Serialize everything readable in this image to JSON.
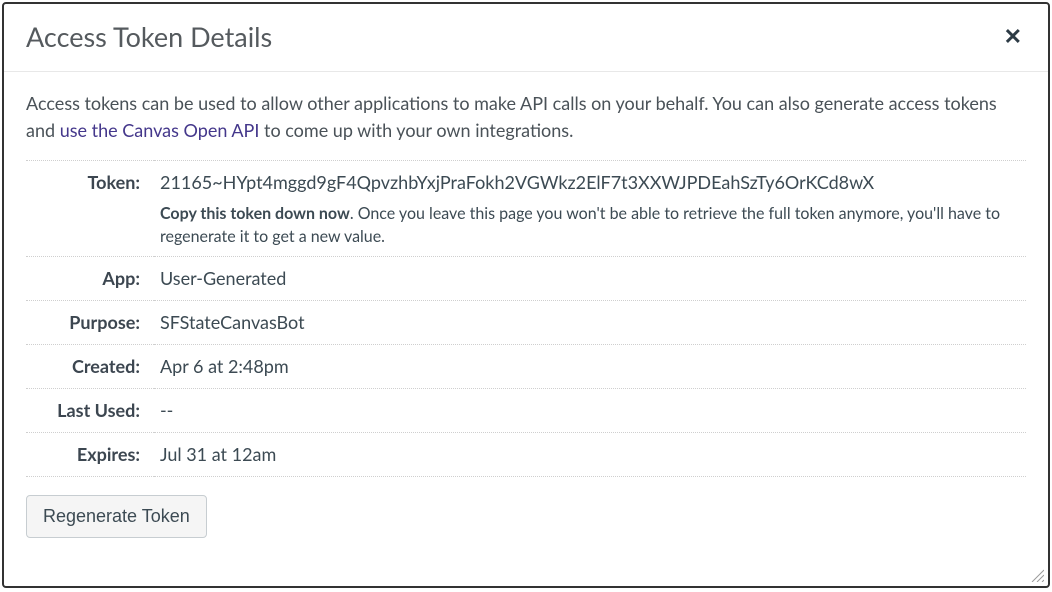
{
  "header": {
    "title": "Access Token Details"
  },
  "intro": {
    "text_before": "Access tokens can be used to allow other applications to make API calls on your behalf. You can also generate access tokens and ",
    "link_text": "use the Canvas Open API",
    "text_after": " to come up with your own integrations."
  },
  "details": {
    "token_label": "Token:",
    "token_value": "21165~HYpt4mggd9gF4QpvzhbYxjPraFokh2VGWkz2ElF7t3XXWJPDEahSzTy6OrKCd8wX",
    "token_note_bold": "Copy this token down now",
    "token_note_rest": ". Once you leave this page you won't be able to retrieve the full token anymore, you'll have to regenerate it to get a new value.",
    "app_label": "App:",
    "app_value": "User-Generated",
    "purpose_label": "Purpose:",
    "purpose_value": "SFStateCanvasBot",
    "created_label": "Created:",
    "created_value": "Apr 6 at 2:48pm",
    "last_used_label": "Last Used:",
    "last_used_value": "--",
    "expires_label": "Expires:",
    "expires_value": "Jul 31 at 12am"
  },
  "actions": {
    "regenerate_label": "Regenerate Token"
  }
}
